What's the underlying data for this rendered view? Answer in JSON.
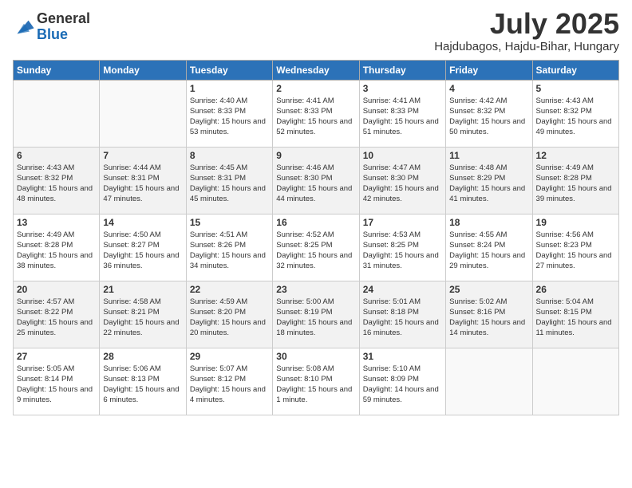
{
  "logo": {
    "general": "General",
    "blue": "Blue"
  },
  "header": {
    "month": "July 2025",
    "location": "Hajdubagos, Hajdu-Bihar, Hungary"
  },
  "weekdays": [
    "Sunday",
    "Monday",
    "Tuesday",
    "Wednesday",
    "Thursday",
    "Friday",
    "Saturday"
  ],
  "weeks": [
    [
      {
        "day": "",
        "sunrise": "",
        "sunset": "",
        "daylight": ""
      },
      {
        "day": "",
        "sunrise": "",
        "sunset": "",
        "daylight": ""
      },
      {
        "day": "1",
        "sunrise": "Sunrise: 4:40 AM",
        "sunset": "Sunset: 8:33 PM",
        "daylight": "Daylight: 15 hours and 53 minutes."
      },
      {
        "day": "2",
        "sunrise": "Sunrise: 4:41 AM",
        "sunset": "Sunset: 8:33 PM",
        "daylight": "Daylight: 15 hours and 52 minutes."
      },
      {
        "day": "3",
        "sunrise": "Sunrise: 4:41 AM",
        "sunset": "Sunset: 8:33 PM",
        "daylight": "Daylight: 15 hours and 51 minutes."
      },
      {
        "day": "4",
        "sunrise": "Sunrise: 4:42 AM",
        "sunset": "Sunset: 8:32 PM",
        "daylight": "Daylight: 15 hours and 50 minutes."
      },
      {
        "day": "5",
        "sunrise": "Sunrise: 4:43 AM",
        "sunset": "Sunset: 8:32 PM",
        "daylight": "Daylight: 15 hours and 49 minutes."
      }
    ],
    [
      {
        "day": "6",
        "sunrise": "Sunrise: 4:43 AM",
        "sunset": "Sunset: 8:32 PM",
        "daylight": "Daylight: 15 hours and 48 minutes."
      },
      {
        "day": "7",
        "sunrise": "Sunrise: 4:44 AM",
        "sunset": "Sunset: 8:31 PM",
        "daylight": "Daylight: 15 hours and 47 minutes."
      },
      {
        "day": "8",
        "sunrise": "Sunrise: 4:45 AM",
        "sunset": "Sunset: 8:31 PM",
        "daylight": "Daylight: 15 hours and 45 minutes."
      },
      {
        "day": "9",
        "sunrise": "Sunrise: 4:46 AM",
        "sunset": "Sunset: 8:30 PM",
        "daylight": "Daylight: 15 hours and 44 minutes."
      },
      {
        "day": "10",
        "sunrise": "Sunrise: 4:47 AM",
        "sunset": "Sunset: 8:30 PM",
        "daylight": "Daylight: 15 hours and 42 minutes."
      },
      {
        "day": "11",
        "sunrise": "Sunrise: 4:48 AM",
        "sunset": "Sunset: 8:29 PM",
        "daylight": "Daylight: 15 hours and 41 minutes."
      },
      {
        "day": "12",
        "sunrise": "Sunrise: 4:49 AM",
        "sunset": "Sunset: 8:28 PM",
        "daylight": "Daylight: 15 hours and 39 minutes."
      }
    ],
    [
      {
        "day": "13",
        "sunrise": "Sunrise: 4:49 AM",
        "sunset": "Sunset: 8:28 PM",
        "daylight": "Daylight: 15 hours and 38 minutes."
      },
      {
        "day": "14",
        "sunrise": "Sunrise: 4:50 AM",
        "sunset": "Sunset: 8:27 PM",
        "daylight": "Daylight: 15 hours and 36 minutes."
      },
      {
        "day": "15",
        "sunrise": "Sunrise: 4:51 AM",
        "sunset": "Sunset: 8:26 PM",
        "daylight": "Daylight: 15 hours and 34 minutes."
      },
      {
        "day": "16",
        "sunrise": "Sunrise: 4:52 AM",
        "sunset": "Sunset: 8:25 PM",
        "daylight": "Daylight: 15 hours and 32 minutes."
      },
      {
        "day": "17",
        "sunrise": "Sunrise: 4:53 AM",
        "sunset": "Sunset: 8:25 PM",
        "daylight": "Daylight: 15 hours and 31 minutes."
      },
      {
        "day": "18",
        "sunrise": "Sunrise: 4:55 AM",
        "sunset": "Sunset: 8:24 PM",
        "daylight": "Daylight: 15 hours and 29 minutes."
      },
      {
        "day": "19",
        "sunrise": "Sunrise: 4:56 AM",
        "sunset": "Sunset: 8:23 PM",
        "daylight": "Daylight: 15 hours and 27 minutes."
      }
    ],
    [
      {
        "day": "20",
        "sunrise": "Sunrise: 4:57 AM",
        "sunset": "Sunset: 8:22 PM",
        "daylight": "Daylight: 15 hours and 25 minutes."
      },
      {
        "day": "21",
        "sunrise": "Sunrise: 4:58 AM",
        "sunset": "Sunset: 8:21 PM",
        "daylight": "Daylight: 15 hours and 22 minutes."
      },
      {
        "day": "22",
        "sunrise": "Sunrise: 4:59 AM",
        "sunset": "Sunset: 8:20 PM",
        "daylight": "Daylight: 15 hours and 20 minutes."
      },
      {
        "day": "23",
        "sunrise": "Sunrise: 5:00 AM",
        "sunset": "Sunset: 8:19 PM",
        "daylight": "Daylight: 15 hours and 18 minutes."
      },
      {
        "day": "24",
        "sunrise": "Sunrise: 5:01 AM",
        "sunset": "Sunset: 8:18 PM",
        "daylight": "Daylight: 15 hours and 16 minutes."
      },
      {
        "day": "25",
        "sunrise": "Sunrise: 5:02 AM",
        "sunset": "Sunset: 8:16 PM",
        "daylight": "Daylight: 15 hours and 14 minutes."
      },
      {
        "day": "26",
        "sunrise": "Sunrise: 5:04 AM",
        "sunset": "Sunset: 8:15 PM",
        "daylight": "Daylight: 15 hours and 11 minutes."
      }
    ],
    [
      {
        "day": "27",
        "sunrise": "Sunrise: 5:05 AM",
        "sunset": "Sunset: 8:14 PM",
        "daylight": "Daylight: 15 hours and 9 minutes."
      },
      {
        "day": "28",
        "sunrise": "Sunrise: 5:06 AM",
        "sunset": "Sunset: 8:13 PM",
        "daylight": "Daylight: 15 hours and 6 minutes."
      },
      {
        "day": "29",
        "sunrise": "Sunrise: 5:07 AM",
        "sunset": "Sunset: 8:12 PM",
        "daylight": "Daylight: 15 hours and 4 minutes."
      },
      {
        "day": "30",
        "sunrise": "Sunrise: 5:08 AM",
        "sunset": "Sunset: 8:10 PM",
        "daylight": "Daylight: 15 hours and 1 minute."
      },
      {
        "day": "31",
        "sunrise": "Sunrise: 5:10 AM",
        "sunset": "Sunset: 8:09 PM",
        "daylight": "Daylight: 14 hours and 59 minutes."
      },
      {
        "day": "",
        "sunrise": "",
        "sunset": "",
        "daylight": ""
      },
      {
        "day": "",
        "sunrise": "",
        "sunset": "",
        "daylight": ""
      }
    ]
  ]
}
